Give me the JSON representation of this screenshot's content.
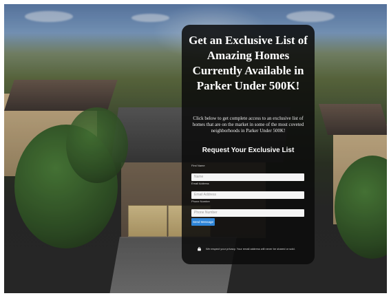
{
  "form": {
    "heading": "Get an Exclusive List of Amazing Homes Currently Available in Parker Under 500K!",
    "description": "Click below to get complete access to an exclusive list of homes that are on the market in some of the most coveted neighborhoods in Parker Under 500K!",
    "subheading": "Request Your Exclusive List",
    "fields": [
      {
        "label": "First Name",
        "placeholder": "Name"
      },
      {
        "label": "Email Address",
        "placeholder": "Email Address"
      },
      {
        "label": "Phone Number",
        "placeholder": "Phone Number"
      }
    ],
    "submit_label": "Send Message",
    "privacy_text": "We respect your privacy. Your email address will never be shared or sold."
  },
  "icons": {
    "privacy": "lock-icon"
  },
  "colors": {
    "card_bg": "#0c0c0c",
    "button_bg": "#2e84d6"
  }
}
